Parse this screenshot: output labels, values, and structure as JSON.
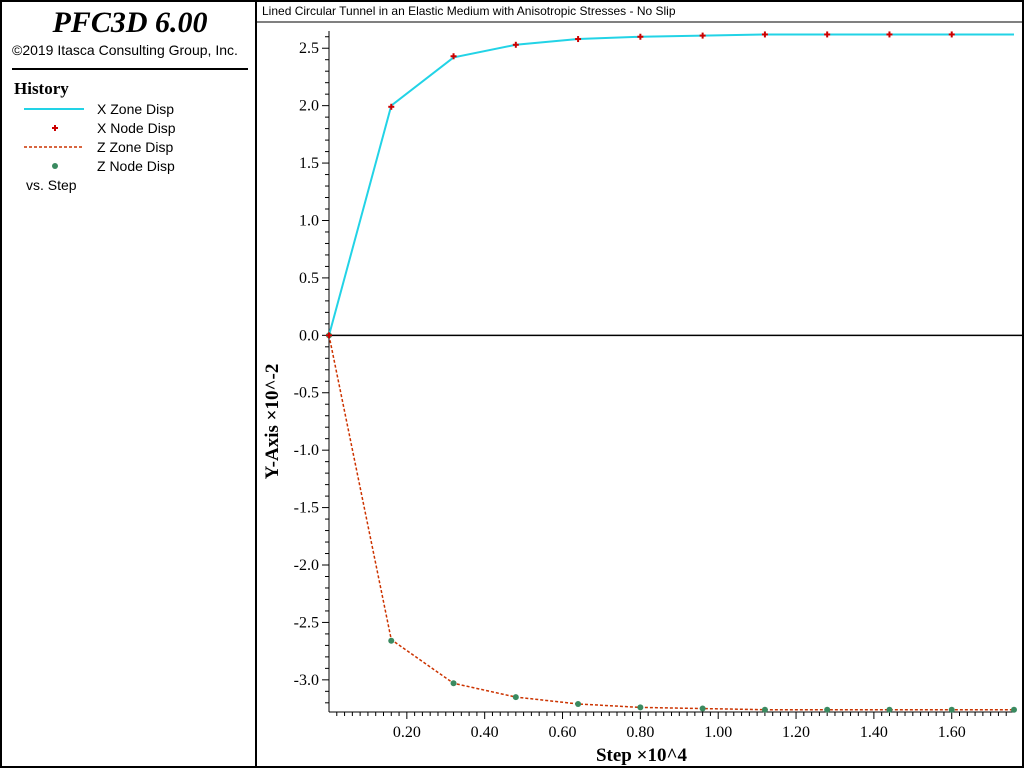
{
  "app": {
    "title": "PFC3D 6.00",
    "copyright": "©2019 Itasca Consulting Group, Inc."
  },
  "legend": {
    "title": "History",
    "items": [
      {
        "label": "X Zone Disp",
        "style": "line",
        "color": "#22d3e6"
      },
      {
        "label": "X Node Disp",
        "style": "plus",
        "color": "#cc0000"
      },
      {
        "label": "Z Zone Disp",
        "style": "dashed",
        "color": "#cc3300"
      },
      {
        "label": "Z Node Disp",
        "style": "dot",
        "color": "#3a8a60"
      }
    ],
    "vs_label": "vs. Step"
  },
  "chart_data": {
    "type": "line",
    "title": "Lined Circular Tunnel in an Elastic Medium with Anisotropic Stresses - No Slip",
    "xlabel": "Step ×10^4",
    "ylabel": "Y-Axis ×10^-2",
    "xlim": [
      0.0,
      1.76
    ],
    "ylim": [
      -3.28,
      2.65
    ],
    "x_ticks": [
      "0.20",
      "0.40",
      "0.60",
      "0.80",
      "1.00",
      "1.20",
      "1.40",
      "1.60"
    ],
    "y_ticks": [
      "2.5",
      "2.0",
      "1.5",
      "1.0",
      "0.5",
      "0.0",
      "-0.5",
      "-1.0",
      "-1.5",
      "-2.0",
      "-2.5",
      "-3.0"
    ],
    "series": [
      {
        "name": "X Zone Disp",
        "x": [
          0.0,
          0.16,
          0.32,
          0.48,
          0.64,
          0.8,
          0.96,
          1.12,
          1.28,
          1.44,
          1.6,
          1.76
        ],
        "y": [
          0.0,
          2.0,
          2.42,
          2.53,
          2.58,
          2.6,
          2.61,
          2.62,
          2.62,
          2.62,
          2.62,
          2.62
        ],
        "color": "#22d3e6"
      },
      {
        "name": "X Node Disp",
        "x": [
          0.0,
          0.16,
          0.32,
          0.48,
          0.64,
          0.8,
          0.96,
          1.12,
          1.28,
          1.44,
          1.6
        ],
        "y": [
          0.0,
          1.99,
          2.43,
          2.53,
          2.58,
          2.6,
          2.61,
          2.62,
          2.62,
          2.62,
          2.62
        ],
        "color": "#cc0000"
      },
      {
        "name": "Z Zone Disp",
        "x": [
          0.0,
          0.16,
          0.32,
          0.48,
          0.64,
          0.8,
          0.96,
          1.12,
          1.28,
          1.44,
          1.6,
          1.76
        ],
        "y": [
          0.0,
          -2.65,
          -3.03,
          -3.15,
          -3.21,
          -3.24,
          -3.25,
          -3.26,
          -3.26,
          -3.26,
          -3.26,
          -3.26
        ],
        "color": "#cc3300"
      },
      {
        "name": "Z Node Disp",
        "x": [
          0.0,
          0.16,
          0.32,
          0.48,
          0.64,
          0.8,
          0.96,
          1.12,
          1.28,
          1.44,
          1.6,
          1.76
        ],
        "y": [
          0.0,
          -2.66,
          -3.03,
          -3.15,
          -3.21,
          -3.24,
          -3.25,
          -3.26,
          -3.26,
          -3.26,
          -3.26,
          -3.26
        ],
        "color": "#3a8a60"
      }
    ]
  }
}
